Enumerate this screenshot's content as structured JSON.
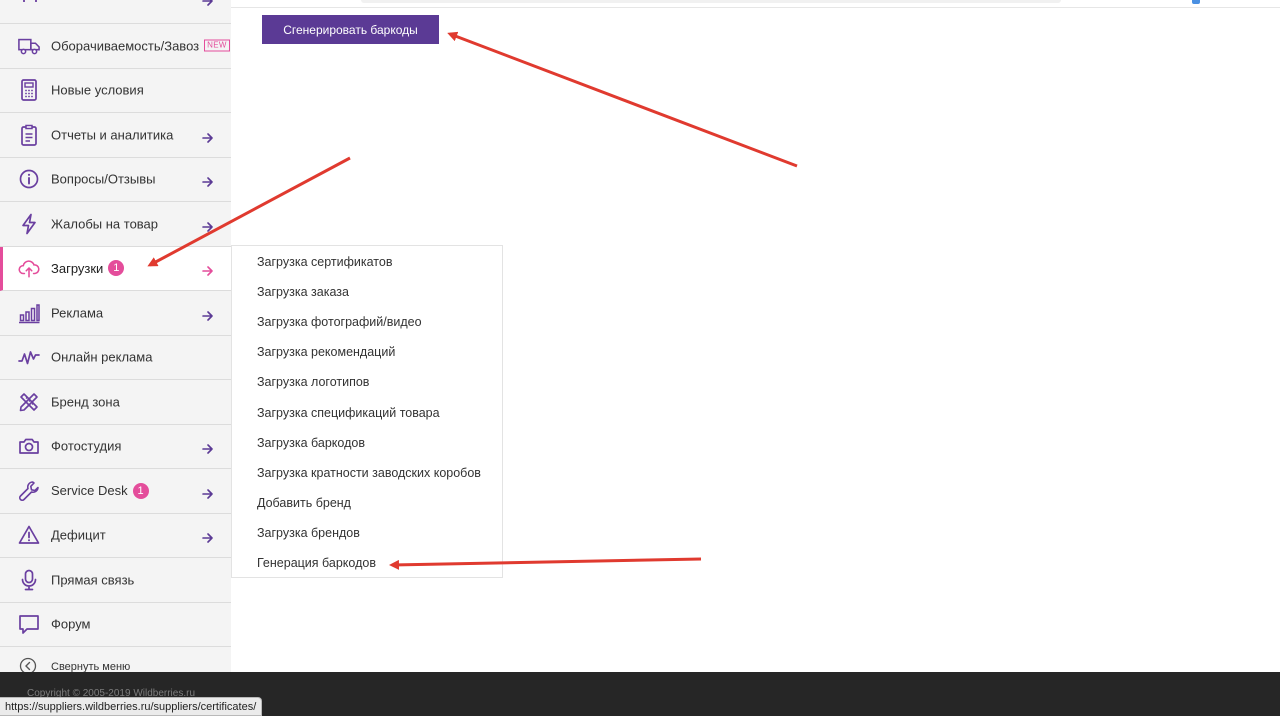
{
  "sidebar": {
    "items": [
      {
        "label": "Оборачиваемость/Завоз",
        "icon": "truck-icon",
        "new": "NEW",
        "arrow": false
      },
      {
        "label": "Новые условия",
        "icon": "calculator-icon",
        "arrow": false
      },
      {
        "label": "Отчеты и аналитика",
        "icon": "clipboard-icon",
        "arrow": true
      },
      {
        "label": "Вопросы/Отзывы",
        "icon": "info-icon",
        "arrow": true
      },
      {
        "label": "Жалобы на товар",
        "icon": "lightning-icon",
        "arrow": true
      },
      {
        "label": "Загрузки",
        "icon": "cloud-upload-icon",
        "badge": "1",
        "arrow": true,
        "active": true
      },
      {
        "label": "Реклама",
        "icon": "bar-chart-icon",
        "arrow": true
      },
      {
        "label": "Онлайн реклама",
        "icon": "pulse-icon",
        "arrow": false
      },
      {
        "label": "Бренд зона",
        "icon": "pencil-ruler-icon",
        "arrow": false
      },
      {
        "label": "Фотостудия",
        "icon": "camera-icon",
        "arrow": true
      },
      {
        "label": "Service Desk",
        "icon": "wrench-icon",
        "badge": "1",
        "arrow": true
      },
      {
        "label": "Дефицит",
        "icon": "warning-icon",
        "arrow": true
      },
      {
        "label": "Прямая связь",
        "icon": "microphone-icon",
        "arrow": false
      },
      {
        "label": "Форум",
        "icon": "chat-icon",
        "arrow": false
      }
    ],
    "collapse_label": "Свернуть меню"
  },
  "main": {
    "generate_button": "Сгенерировать баркоды"
  },
  "dropdown": {
    "items": [
      "Загрузка сертификатов",
      "Загрузка заказа",
      "Загрузка фотографий/видео",
      "Загрузка рекомендаций",
      "Загрузка логотипов",
      "Загрузка спецификаций товара",
      "Загрузка баркодов",
      "Загрузка кратности заводских коробов",
      "Добавить бренд",
      "Загрузка брендов",
      "Генерация баркодов"
    ]
  },
  "footer": {
    "copyright": "Copyright © 2005-2019 Wildberries.ru"
  },
  "status_bar": {
    "url": "https://suppliers.wildberries.ru/suppliers/certificates/"
  },
  "colors": {
    "accent_purple": "#5b3a95",
    "icon_purple": "#6a3fa0",
    "pink": "#e44d9b",
    "annotation_red": "#e03a2f"
  }
}
